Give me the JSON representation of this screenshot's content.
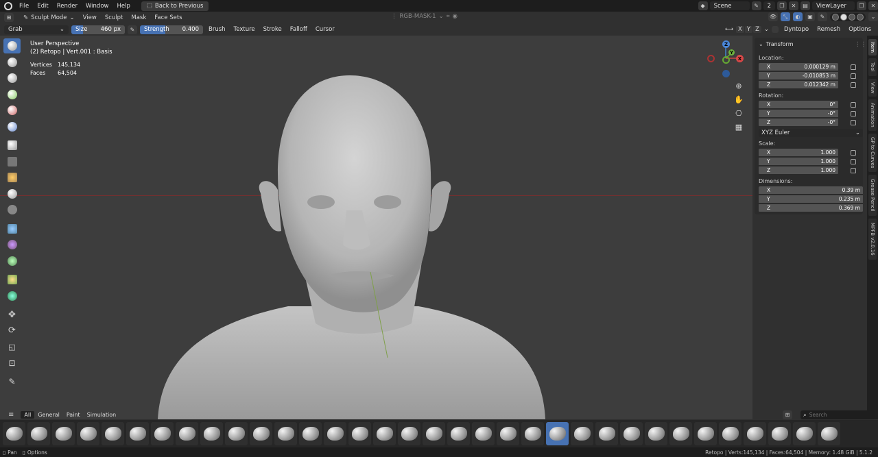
{
  "topbar": {
    "menus": [
      "File",
      "Edit",
      "Render",
      "Window",
      "Help"
    ],
    "back_label": "Back to Previous",
    "scene": "Scene",
    "scene_count": "2",
    "view_layer": "ViewLayer"
  },
  "header": {
    "mode": "Sculpt Mode",
    "menus": [
      "View",
      "Sculpt",
      "Mask",
      "Face Sets"
    ],
    "color_attr": "RGB-MASK-1"
  },
  "toolsettings": {
    "brush": "Grab",
    "size_label": "Size",
    "size_value": "460 px",
    "strength_label": "Strength",
    "strength_value": "0.400",
    "menus": [
      "Brush",
      "Texture",
      "Stroke",
      "Falloff",
      "Cursor"
    ],
    "axes": [
      "X",
      "Y",
      "Z"
    ],
    "dyntopo": "Dyntopo",
    "remesh": "Remesh",
    "options": "Options"
  },
  "viewport": {
    "perspective": "User Perspective",
    "object_info": "(2) Retopo | Vert.001 : Basis",
    "vertices_label": "Vertices",
    "vertices_value": "145,134",
    "faces_label": "Faces",
    "faces_value": "64,504"
  },
  "gizmo": {
    "x": "X",
    "y": "Y",
    "z": "Z"
  },
  "npanel": {
    "title": "Transform",
    "location_label": "Location:",
    "location": [
      {
        "axis": "X",
        "value": "0.000129 m"
      },
      {
        "axis": "Y",
        "value": "-0.010853 m"
      },
      {
        "axis": "Z",
        "value": "0.012342 m"
      }
    ],
    "rotation_label": "Rotation:",
    "rotation": [
      {
        "axis": "X",
        "value": "0°"
      },
      {
        "axis": "Y",
        "value": "-0°"
      },
      {
        "axis": "Z",
        "value": "-0°"
      }
    ],
    "rotation_mode": "XYZ Euler",
    "scale_label": "Scale:",
    "scale": [
      {
        "axis": "X",
        "value": "1.000"
      },
      {
        "axis": "Y",
        "value": "1.000"
      },
      {
        "axis": "Z",
        "value": "1.000"
      }
    ],
    "dimensions_label": "Dimensions:",
    "dimensions": [
      {
        "axis": "X",
        "value": "0.39 m"
      },
      {
        "axis": "Y",
        "value": "0.235 m"
      },
      {
        "axis": "Z",
        "value": "0.369 m"
      }
    ]
  },
  "sidetabs": [
    "Item",
    "Tool",
    "View",
    "Animation",
    "GP to Curves",
    "Grease Pencil",
    "MPFB v2.0.16"
  ],
  "shelf": {
    "tabs": [
      "All",
      "General",
      "Paint",
      "Simulation"
    ],
    "search_placeholder": "Search"
  },
  "status": {
    "pan": "Pan",
    "options": "Options",
    "stats": "Retopo | Verts:145,134 | Faces:64,504 | Memory: 1.48 GiB | 5.1.2"
  }
}
